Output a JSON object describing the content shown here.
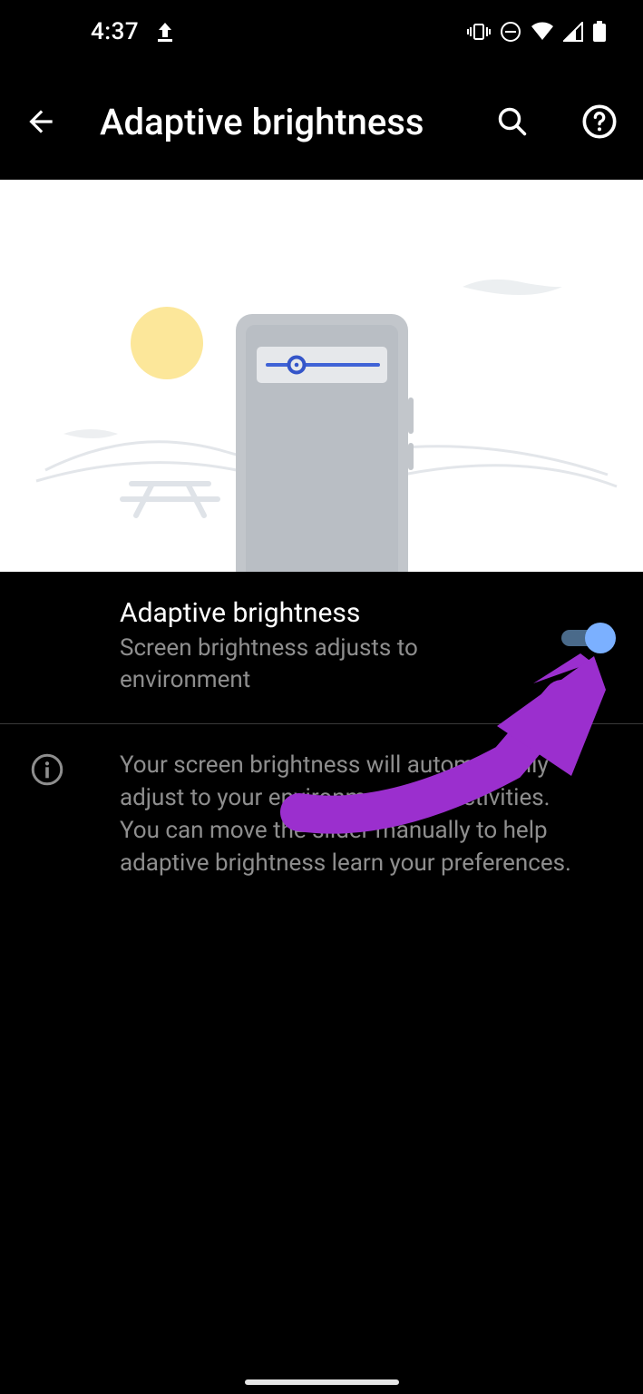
{
  "status": {
    "time": "4:37"
  },
  "header": {
    "title": "Adaptive brightness"
  },
  "setting": {
    "title": "Adaptive brightness",
    "subtitle": "Screen brightness adjusts to environment",
    "toggle_on": true
  },
  "info": {
    "body": "Your screen brightness will automatically adjust to your environment and activities. You can move the slider manually to help adaptive brightness learn your preferences."
  },
  "colors": {
    "annotation_arrow": "#9b2fce",
    "toggle_thumb": "#7bb0ff",
    "toggle_track": "#4a6a8a"
  }
}
